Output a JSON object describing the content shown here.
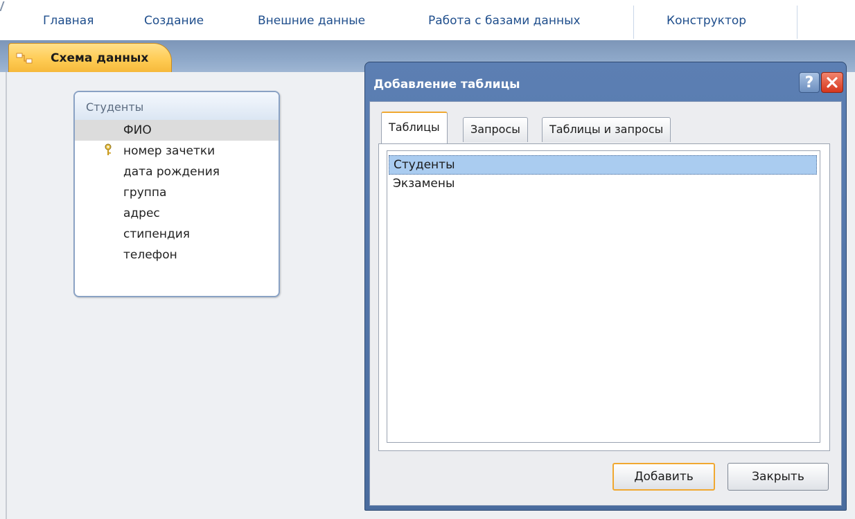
{
  "ribbon": {
    "tabs": [
      "Главная",
      "Создание",
      "Внешние данные",
      "Работа с базами данных",
      "Конструктор"
    ]
  },
  "doc_tab": {
    "label": "Схема данных",
    "icon": "relationships-icon"
  },
  "table_box": {
    "title": "Студенты",
    "fields": [
      "ФИО",
      "номер зачетки",
      "дата рождения",
      "группа",
      "адрес",
      "стипендия",
      "телефон"
    ],
    "primary_key_field": "номер зачетки",
    "selected_field": "ФИО"
  },
  "dialog": {
    "title": "Добавление таблицы",
    "help": "?",
    "tabs": [
      "Таблицы",
      "Запросы",
      "Таблицы и запросы"
    ],
    "active_tab": "Таблицы",
    "list_items": [
      "Студенты",
      "Экзамены"
    ],
    "selected_item": "Студенты",
    "add_label": "Добавить",
    "close_label": "Закрыть"
  },
  "colors": {
    "accent_orange": "#f0a830",
    "ribbon_text": "#1f4e8c",
    "dialog_frame": "#4a6c9e",
    "selection": "#aaccf0",
    "close_red": "#d6361c"
  }
}
